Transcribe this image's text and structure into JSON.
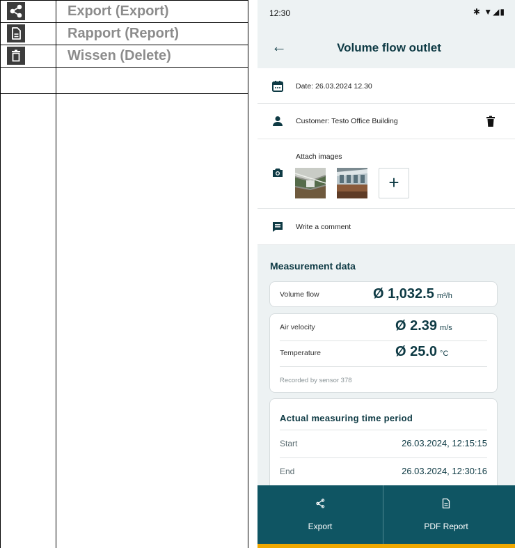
{
  "legend": {
    "items": [
      {
        "icon": "share-icon",
        "label": "Export (Export)"
      },
      {
        "icon": "document-icon",
        "label": "Rapport (Report)"
      },
      {
        "icon": "trash-icon",
        "label": "Wissen (Delete)"
      }
    ]
  },
  "phone": {
    "status": {
      "time": "12:30",
      "icons": "✱ ▼◢▮"
    },
    "appbar": {
      "title": "Volume flow outlet",
      "back_icon": "arrow-left-icon"
    },
    "date": "Date: 26.03.2024 12.30",
    "customer": "Customer: Testo Office Building",
    "attach_label": "Attach images",
    "add_label": "+",
    "comment": "Write a comment",
    "measurement": {
      "heading": "Measurement data",
      "volume": {
        "label": "Volume flow",
        "value": "Ø 1,032.5",
        "unit": "m³/h"
      },
      "air": {
        "label": "Air velocity",
        "value": "Ø 2.39",
        "unit": "m/s"
      },
      "temp": {
        "label": "Temperature",
        "value": "Ø 25.0",
        "unit": "°C"
      },
      "sensor_note": "Recorded by sensor  378",
      "period": {
        "title": "Actual measuring time period",
        "start_label": "Start",
        "start_value": "26.03.2024, 12:15:15",
        "end_label": "End",
        "end_value": "26.03.2024, 12:30:16"
      }
    },
    "bottom": {
      "export_label": "Export",
      "report_label": "PDF Report"
    },
    "colors": {
      "primary": "#0f5563",
      "accent": "#f0a800",
      "surface": "#edf2f3"
    }
  }
}
